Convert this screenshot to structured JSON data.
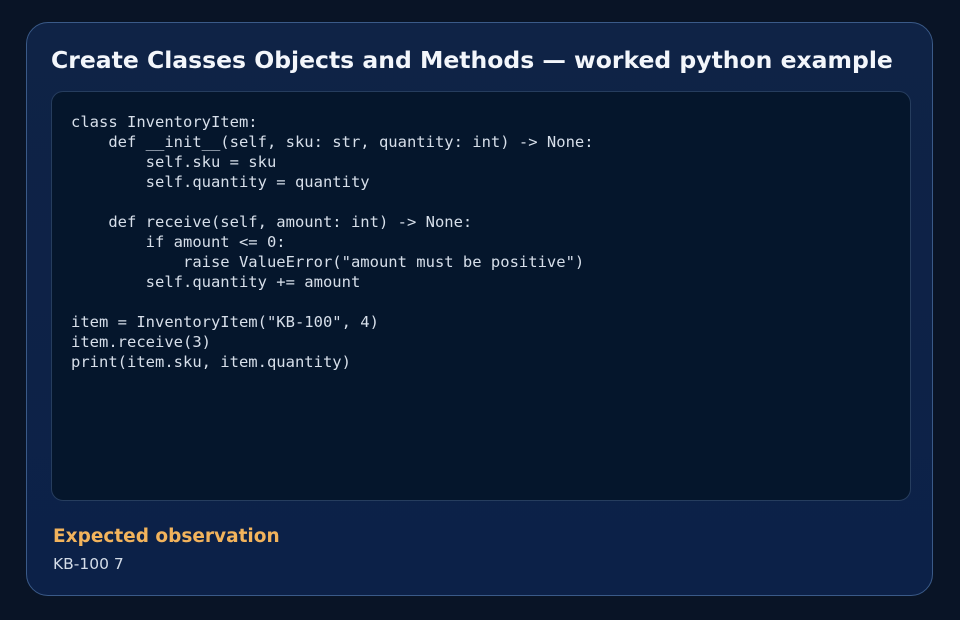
{
  "card": {
    "title": "Create Classes Objects and Methods — worked python example",
    "code": "class InventoryItem:\n    def __init__(self, sku: str, quantity: int) -> None:\n        self.sku = sku\n        self.quantity = quantity\n\n    def receive(self, amount: int) -> None:\n        if amount <= 0:\n            raise ValueError(\"amount must be positive\")\n        self.quantity += amount\n\nitem = InventoryItem(\"KB-100\", 4)\nitem.receive(3)\nprint(item.sku, item.quantity)",
    "observation_label": "Expected observation",
    "observation_value": "KB-100 7"
  },
  "colors": {
    "page_background": "#091426",
    "card_background": "#0e2247",
    "card_border": "#3a5a88",
    "code_background": "#05162c",
    "title_text": "#f3f6fb",
    "code_text": "#d7dfea",
    "accent_label": "#f2b35c"
  }
}
